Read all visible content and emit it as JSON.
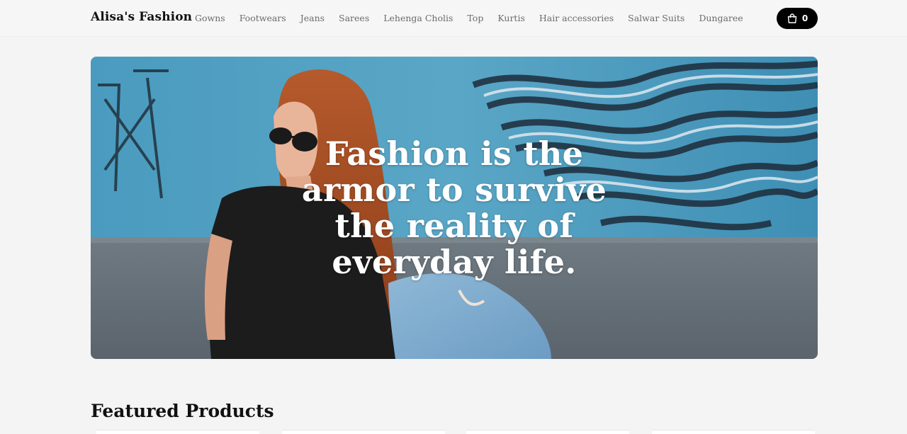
{
  "header": {
    "brand": "Alisa's Fashion",
    "nav": [
      "Gowns",
      "Footwears",
      "Jeans",
      "Sarees",
      "Lehenga Cholis",
      "Top",
      "Kurtis",
      "Hair accessories",
      "Salwar Suits",
      "Dungaree"
    ],
    "cart": {
      "icon": "shopping-bag-icon",
      "count": "0"
    }
  },
  "hero": {
    "headline": "Fashion is the armor to survive the reality of everyday life."
  },
  "featured": {
    "title": "Featured Products"
  },
  "colors": {
    "background": "#f4f4f4",
    "cart_button": "#000000",
    "nav_text": "#6b6b6b",
    "hero_wall": "#4f9dc0"
  }
}
